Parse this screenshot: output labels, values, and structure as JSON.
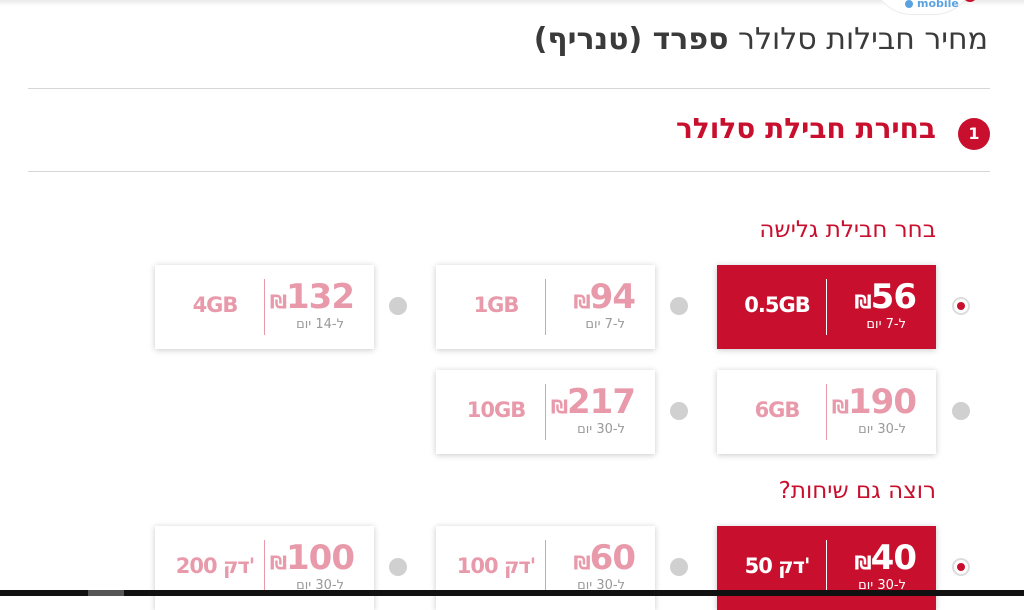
{
  "logo": {
    "text": "mobile"
  },
  "page": {
    "title_prefix": "מחיר חבילות סלולר",
    "title_destination": "ספרד (טנריף)"
  },
  "step1": {
    "number": "1",
    "title": "בחירת חבילת סלולר"
  },
  "data_packages": {
    "title": "בחר חבילת גלישה",
    "packages": [
      {
        "price": "56",
        "currency": "₪",
        "duration": "ל-7 יום",
        "amount": "0.5GB",
        "selected": true
      },
      {
        "price": "94",
        "currency": "₪",
        "duration": "ל-7 יום",
        "amount": "1GB",
        "selected": false
      },
      {
        "price": "132",
        "currency": "₪",
        "duration": "ל-14 יום",
        "amount": "4GB",
        "selected": false
      },
      {
        "price": "190",
        "currency": "₪",
        "duration": "ל-30 יום",
        "amount": "6GB",
        "selected": false
      },
      {
        "price": "217",
        "currency": "₪",
        "duration": "ל-30 יום",
        "amount": "10GB",
        "selected": false
      }
    ]
  },
  "call_packages": {
    "title": "רוצה גם שיחות?",
    "packages": [
      {
        "price": "40",
        "currency": "₪",
        "duration": "ל-30 יום",
        "amount": "50 דק'",
        "selected": true
      },
      {
        "price": "60",
        "currency": "₪",
        "duration": "ל-30 יום",
        "amount": "100 דק'",
        "selected": false
      },
      {
        "price": "100",
        "currency": "₪",
        "duration": "ל-30 יום",
        "amount": "200 דק'",
        "selected": false
      }
    ]
  },
  "colors": {
    "accent": "#c8102e",
    "muted_price": "#e89aab",
    "text": "#3a3a3a"
  }
}
